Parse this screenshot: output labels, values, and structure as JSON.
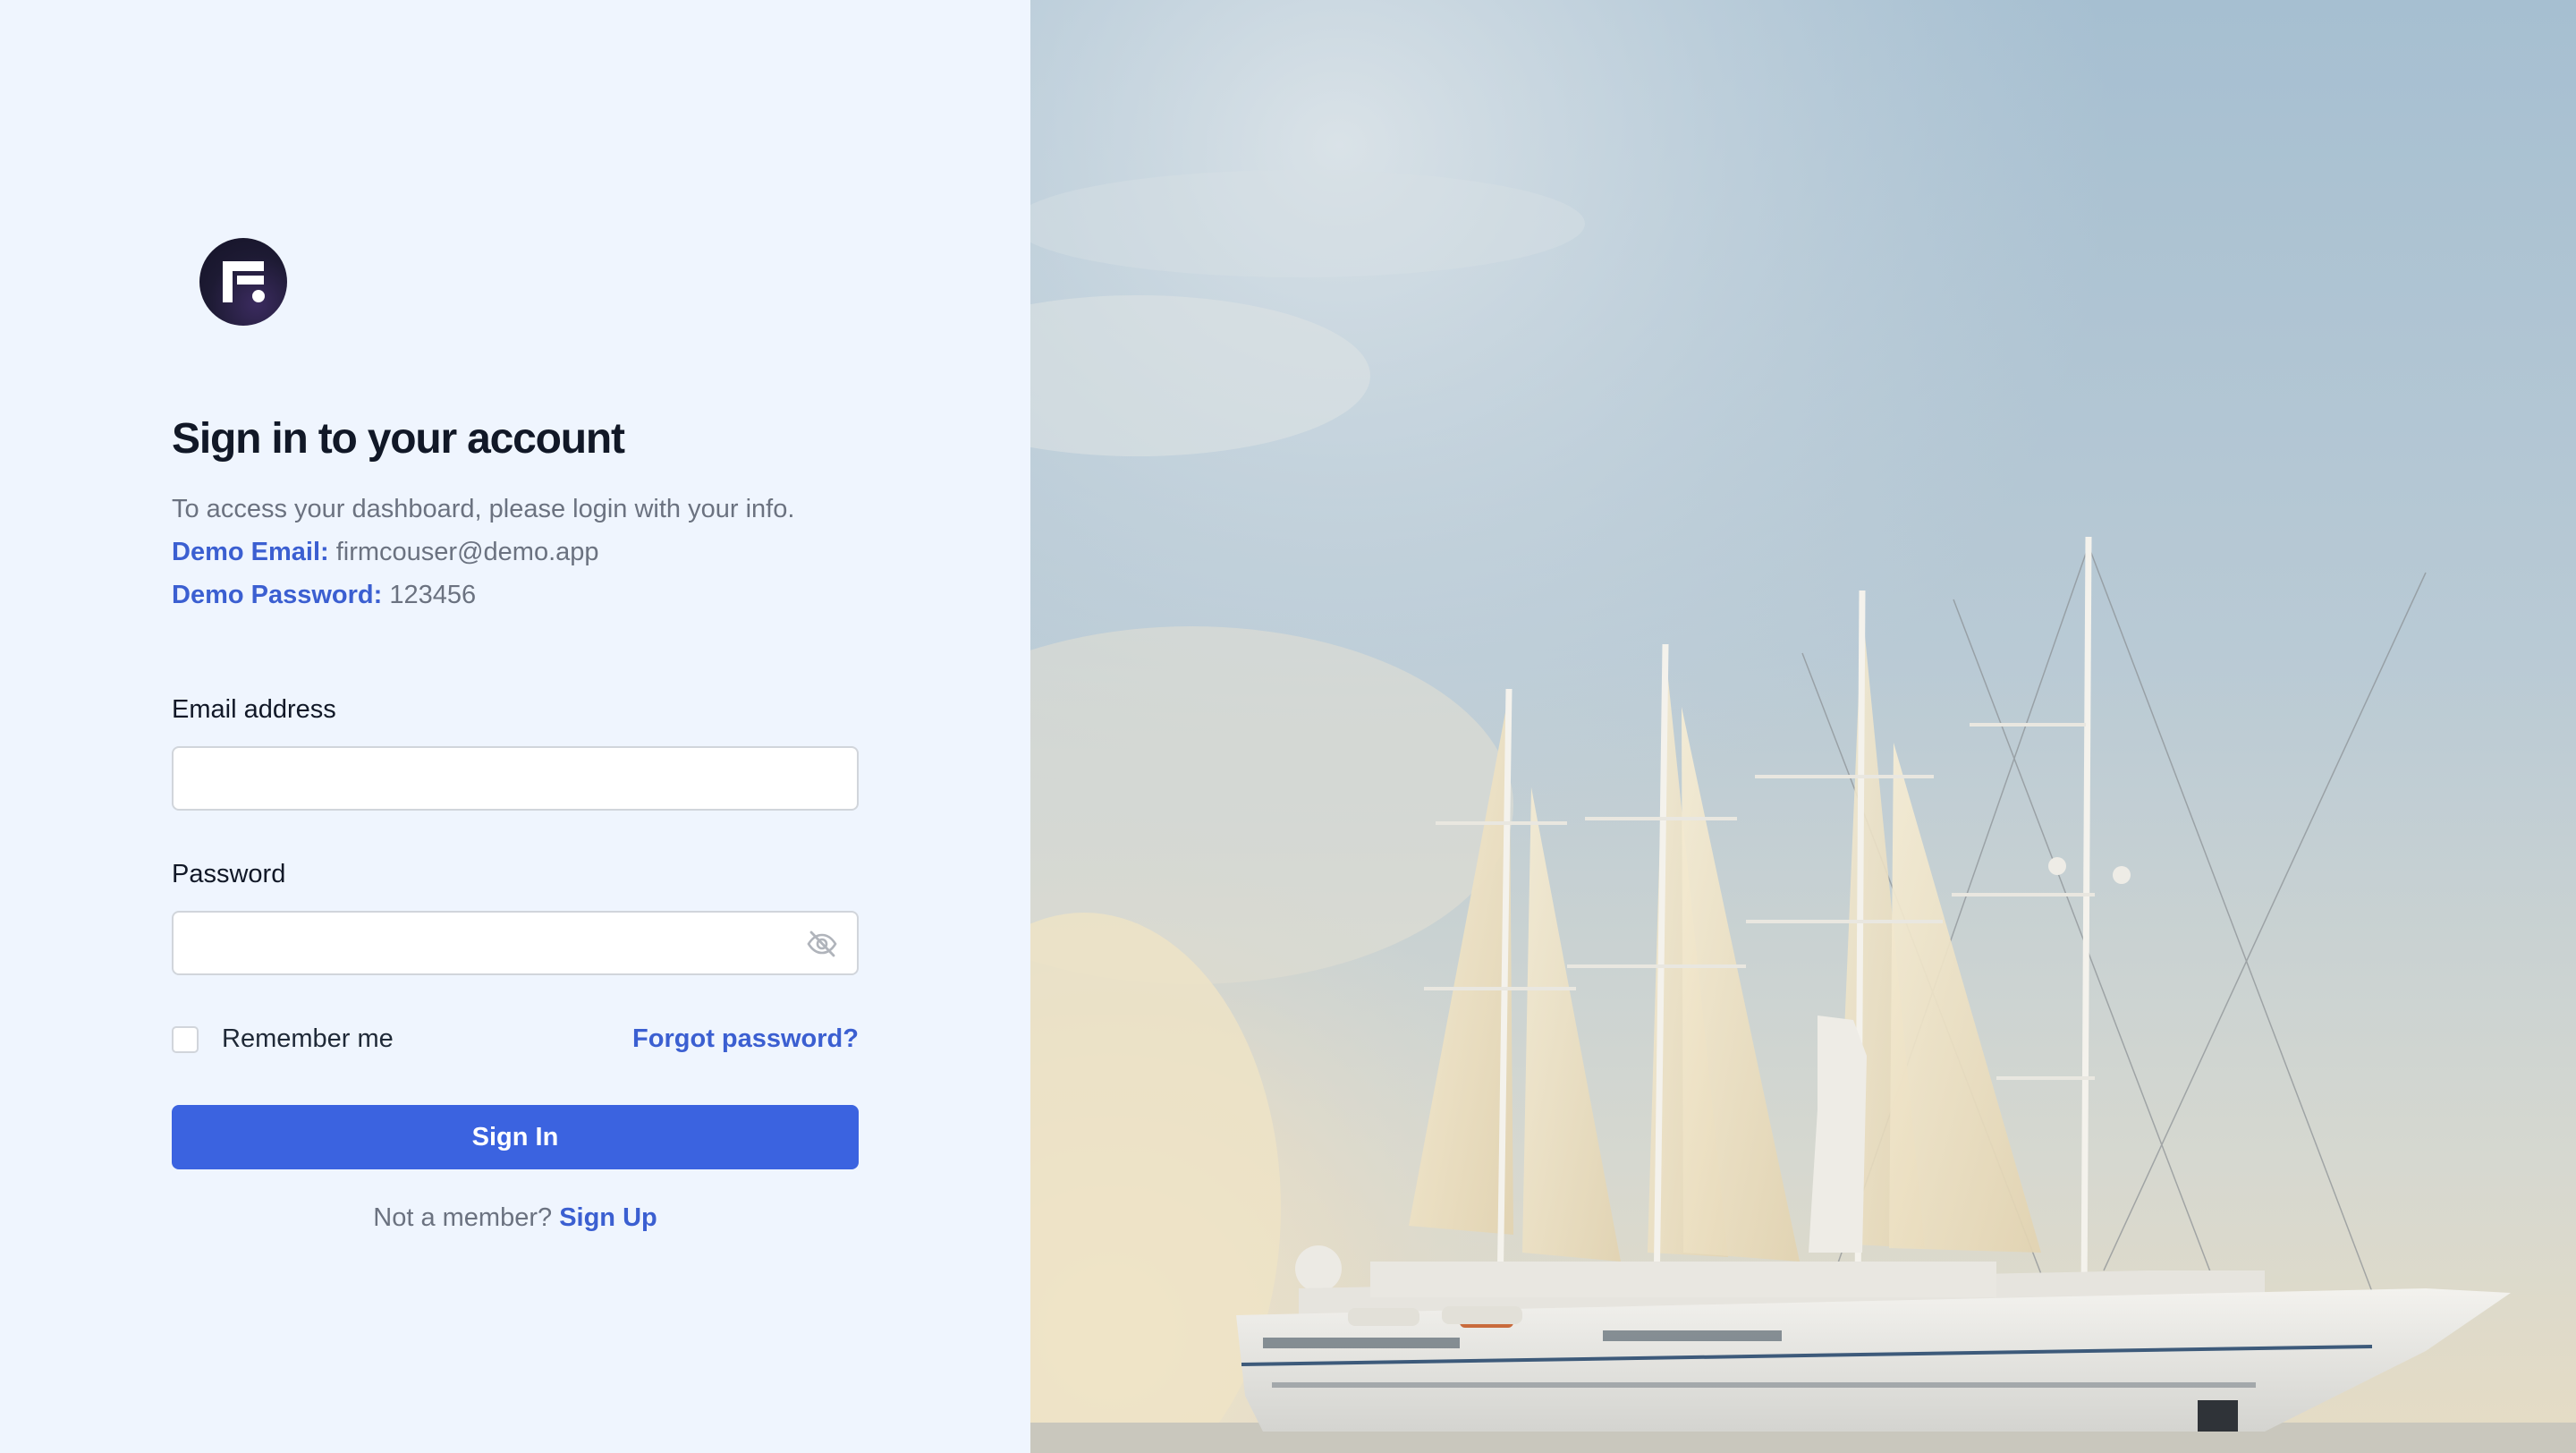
{
  "heading": "Sign in to your account",
  "intro": "To access your dashboard, please login with your info.",
  "demo": {
    "email_label": "Demo Email:",
    "email_value": "firmcouser@demo.app",
    "password_label": "Demo Password:",
    "password_value": "123456"
  },
  "form": {
    "email_label": "Email address",
    "email_value": "",
    "password_label": "Password",
    "password_value": "",
    "remember_label": "Remember me",
    "remember_checked": false,
    "forgot_label": "Forgot password?",
    "submit_label": "Sign In"
  },
  "footer": {
    "prompt": "Not a member?",
    "signup_label": "Sign Up"
  },
  "colors": {
    "accent": "#3b63e0",
    "link": "#3b5fd1",
    "panel_bg": "#eff5fe",
    "logo_bg": "#1d1a33"
  },
  "icons": {
    "logo": "firm-logo-icon",
    "password_toggle": "eye-slash-icon"
  }
}
